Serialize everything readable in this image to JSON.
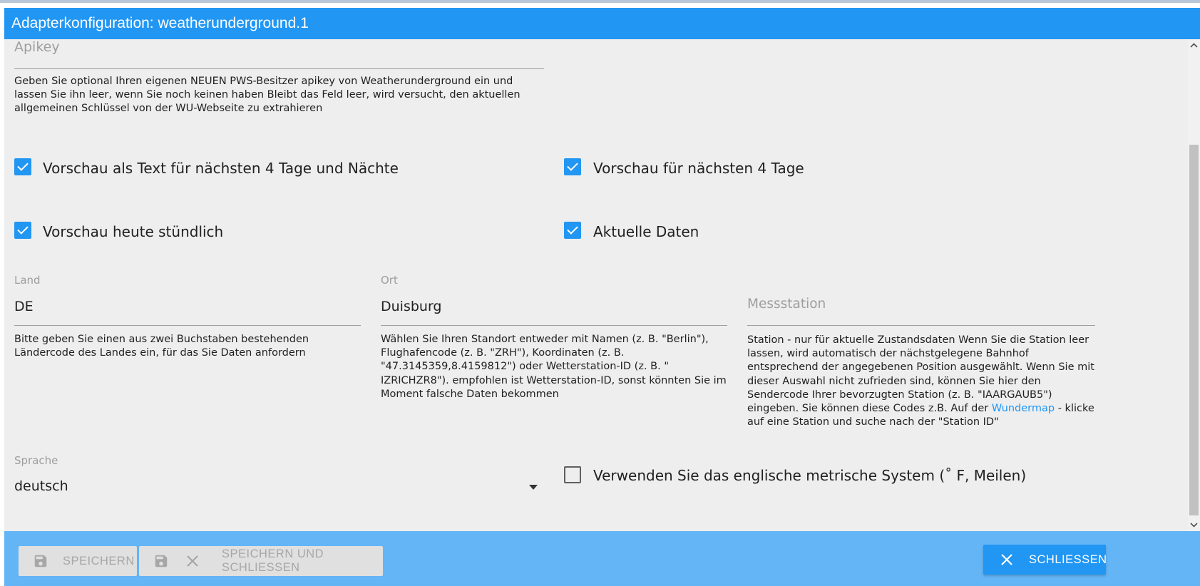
{
  "window": {
    "title": "Adapterkonfiguration: weatherunderground.1"
  },
  "apikey": {
    "label": "Apikey",
    "value": "",
    "helper": "Geben Sie optional Ihren eigenen NEUEN PWS-Besitzer apikey von Weatherunderground ein und lassen Sie ihn leer, wenn Sie noch keinen haben Bleibt das Feld leer, wird versucht, den aktuellen allgemeinen Schlüssel von der WU-Webseite zu extrahieren"
  },
  "checkboxes": {
    "forecast_text": {
      "label": "Vorschau als Text für nächsten 4 Tage und Nächte",
      "checked": true
    },
    "forecast_days": {
      "label": "Vorschau für nächsten 4 Tage",
      "checked": true
    },
    "forecast_hourly": {
      "label": "Vorschau heute stündlich",
      "checked": true
    },
    "current_data": {
      "label": "Aktuelle Daten",
      "checked": true
    },
    "imperial": {
      "label": "Verwenden Sie das englische metrische System (˚ F, Meilen)",
      "checked": false
    }
  },
  "land": {
    "label": "Land",
    "value": "DE",
    "helper": "Bitte geben Sie einen aus zwei Buchstaben bestehenden Ländercode des Landes ein, für das Sie Daten anfordern"
  },
  "ort": {
    "label": "Ort",
    "value": "Duisburg",
    "helper": "Wählen Sie Ihren Standort entweder mit Namen (z. B. \"Berlin\"), Flughafencode (z. B. \"ZRH\"), Koordinaten (z. B. \"47.3145359,8.4159812\") oder Wetterstation-ID (z. B. \" IZRICHZR8\"). empfohlen ist Wetterstation-ID, sonst könnten Sie im Moment falsche Daten bekommen"
  },
  "station": {
    "label": "Messstation",
    "value": "",
    "helper_before": "Station - nur für aktuelle Zustandsdaten Wenn Sie die Station leer lassen, wird automatisch der nächstgelegene Bahnhof entsprechend der angegebenen Position ausgewählt. Wenn Sie mit dieser Auswahl nicht zufrieden sind, können Sie hier den Sendercode Ihrer bevorzugten Station (z. B. \"IAARGAUB5\") eingeben. Sie können diese Codes z.B. Auf der ",
    "helper_link": "Wundermap",
    "helper_after": " - klicke auf eine Station und suche nach der \"Station ID\""
  },
  "sprache": {
    "label": "Sprache",
    "value": "deutsch"
  },
  "footer": {
    "save_label": "SPEICHERN",
    "save_close_label": "SPEICHERN UND SCHLIESSEN",
    "close_label": "SCHLIESSEN"
  },
  "colors": {
    "primary": "#2196f3",
    "footer": "#64b5f6",
    "background": "#eeeeee"
  },
  "icons": [
    "save-icon",
    "close-icon",
    "chevron-up-icon",
    "chevron-down-icon",
    "check-icon",
    "dropdown-arrow-icon"
  ]
}
